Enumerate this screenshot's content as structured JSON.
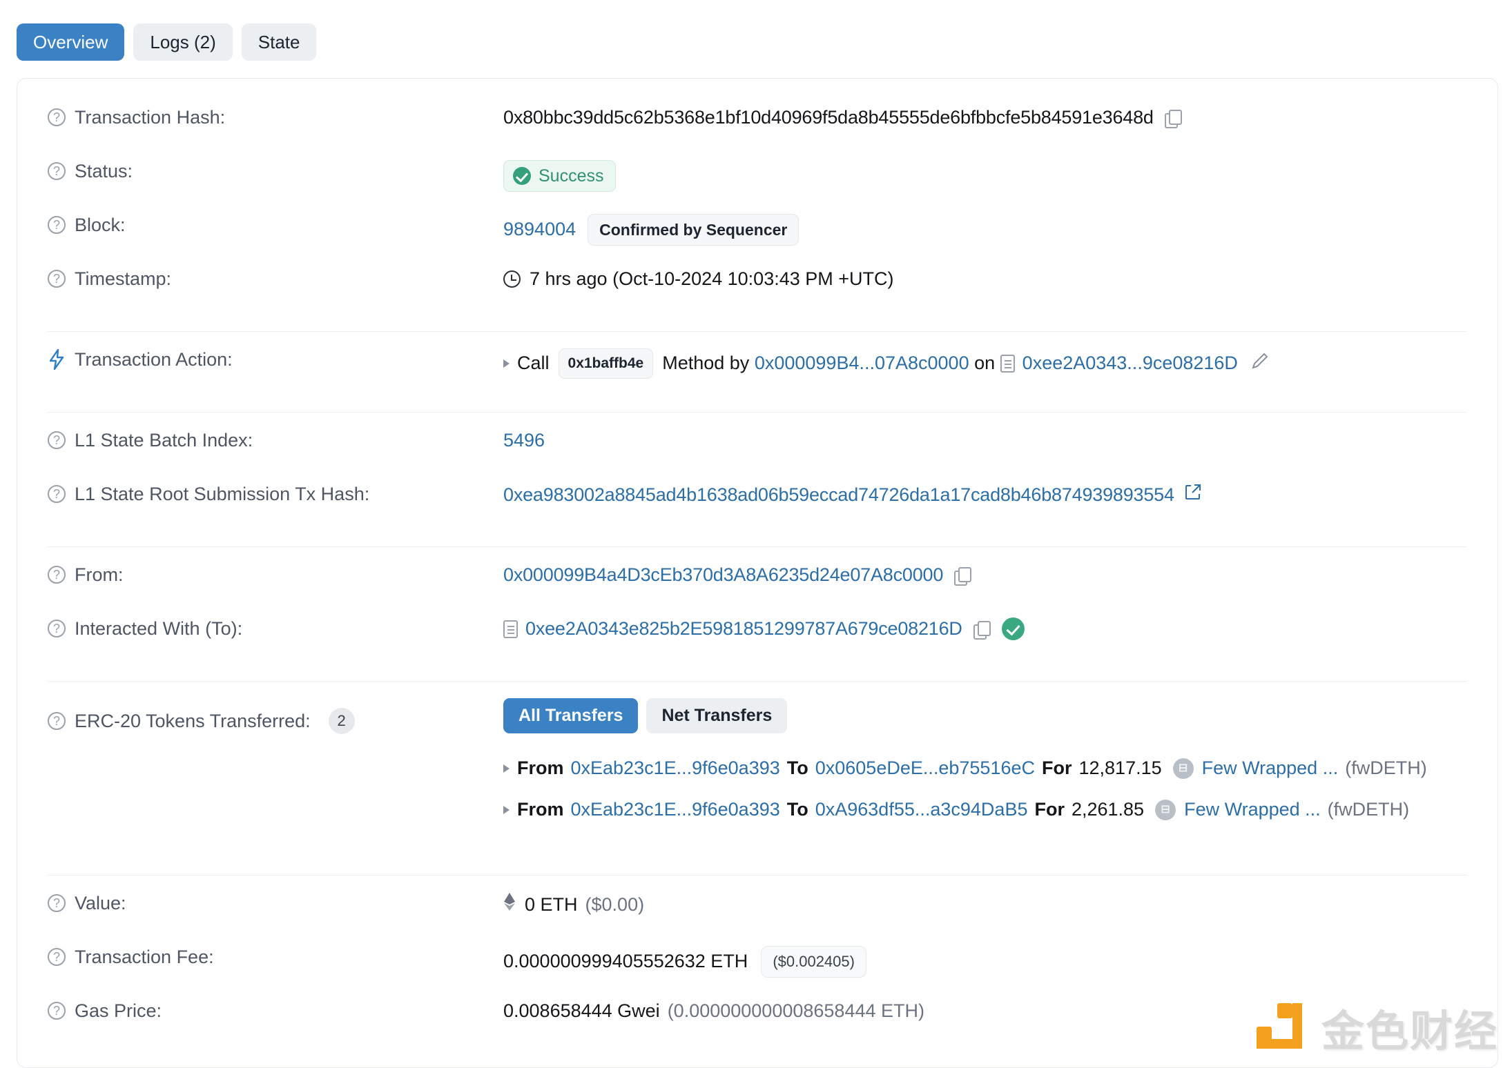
{
  "tabs": [
    {
      "label": "Overview",
      "active": true
    },
    {
      "label": "Logs (2)",
      "active": false
    },
    {
      "label": "State",
      "active": false
    }
  ],
  "colors": {
    "accent_blue": "#3b82c4",
    "link_blue": "#2c6ea5",
    "success_green": "#35a07c",
    "success_bg": "#edf7f2",
    "watermark_orange": "#f2a01e"
  },
  "fields": {
    "transaction_hash": {
      "label": "Transaction Hash:",
      "value": "0x80bbc39dd5c62b5368e1bf10d40969f5da8b45555de6bfbbcfe5b84591e3648d"
    },
    "status": {
      "label": "Status:",
      "value": "Success"
    },
    "block": {
      "label": "Block:",
      "value": "9894004",
      "badge": "Confirmed by Sequencer"
    },
    "timestamp": {
      "label": "Timestamp:",
      "value": "7 hrs ago (Oct-10-2024 10:03:43 PM +UTC)"
    },
    "transaction_action": {
      "label": "Transaction Action:",
      "call_word": "Call",
      "method_id": "0x1baffb4e",
      "method_by": "Method by",
      "actor": "0x000099B4...07A8c0000",
      "on_word": "on",
      "contract": "0xee2A0343...9ce08216D"
    },
    "l1_state_batch_index": {
      "label": "L1 State Batch Index:",
      "value": "5496"
    },
    "l1_state_root_tx_hash": {
      "label": "L1 State Root Submission Tx Hash:",
      "value": "0xea983002a8845ad4b1638ad06b59eccad74726da1a17cad8b46b874939893554"
    },
    "from": {
      "label": "From:",
      "value": "0x000099B4a4D3cEb370d3A8A6235d24e07A8c0000"
    },
    "interacted_with": {
      "label": "Interacted With (To):",
      "value": "0xee2A0343e825b2E5981851299787A679ce08216D"
    },
    "erc20_transfers": {
      "label": "ERC-20 Tokens Transferred:",
      "count": "2",
      "toggle_all": "All Transfers",
      "toggle_net": "Net Transfers",
      "rows": [
        {
          "from_word": "From",
          "from": "0xEab23c1E...9f6e0a393",
          "to_word": "To",
          "to": "0x0605eDeE...eb75516eC",
          "for_word": "For",
          "amount": "12,817.15",
          "token_name": "Few Wrapped ...",
          "token_symbol": "(fwDETH)"
        },
        {
          "from_word": "From",
          "from": "0xEab23c1E...9f6e0a393",
          "to_word": "To",
          "to": "0xA963df55...a3c94DaB5",
          "for_word": "For",
          "amount": "2,261.85",
          "token_name": "Few Wrapped ...",
          "token_symbol": "(fwDETH)"
        }
      ]
    },
    "value": {
      "label": "Value:",
      "amount": "0 ETH",
      "fiat": "($0.00)"
    },
    "transaction_fee": {
      "label": "Transaction Fee:",
      "amount": "0.000000999405552632 ETH",
      "fiat": "($0.002405)"
    },
    "gas_price": {
      "label": "Gas Price:",
      "amount": "0.008658444 Gwei",
      "in_eth": "(0.000000000008658444 ETH)"
    }
  },
  "watermark": {
    "text": "金色财经"
  }
}
